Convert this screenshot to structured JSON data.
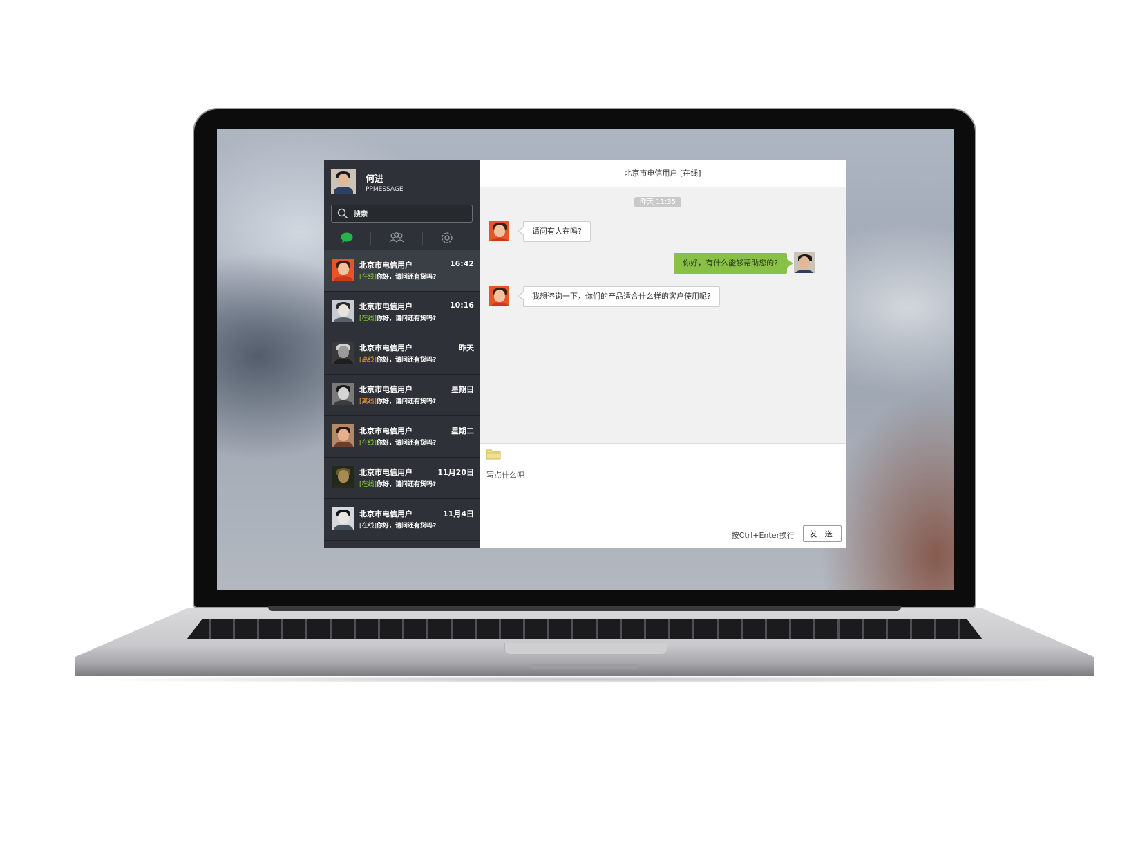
{
  "window": {
    "title": "北京市电信用户 [在线]"
  },
  "me": {
    "name": "何进",
    "subtitle": "PPMESSAGE"
  },
  "search": {
    "placeholder": "搜索"
  },
  "tabs": [
    {
      "icon": "chat-bubble-icon",
      "active": true
    },
    {
      "icon": "contacts-icon",
      "active": false
    },
    {
      "icon": "gear-icon",
      "active": false
    }
  ],
  "colors": {
    "online": "#8fd13a",
    "offline": "#f0a030",
    "sidebar": "#2e3238",
    "bubble_mine": "#88c145"
  },
  "conversations": [
    {
      "name": "北京市电信用户",
      "time": "16:42",
      "status": "[在线]",
      "status_type": "online",
      "preview": "你好，请问还有货吗?"
    },
    {
      "name": "北京市电信用户",
      "time": "10:16",
      "status": "[在线]",
      "status_type": "online",
      "preview": "你好，请问还有货吗?"
    },
    {
      "name": "北京市电信用户",
      "time": "昨天",
      "status": "[离线]",
      "status_type": "offline",
      "preview": "你好，请问还有货吗?"
    },
    {
      "name": "北京市电信用户",
      "time": "星期日",
      "status": "[离线]",
      "status_type": "offline",
      "preview": "你好，请问还有货吗?"
    },
    {
      "name": "北京市电信用户",
      "time": "星期二",
      "status": "[在线]",
      "status_type": "online",
      "preview": "你好，请问还有货吗?"
    },
    {
      "name": "北京市电信用户",
      "time": "11月20日",
      "status": "[在线]",
      "status_type": "online",
      "preview": "你好，请问还有货吗?"
    },
    {
      "name": "北京市电信用户",
      "time": "11月4日",
      "status": "[在线]",
      "status_type": "plain",
      "preview": "你好，请问还有货吗?"
    }
  ],
  "chat": {
    "timestamp": "昨天 11:35",
    "messages": [
      {
        "from": "them",
        "text": "请问有人在吗?"
      },
      {
        "from": "me",
        "text": "你好，有什么能够帮助您的?"
      },
      {
        "from": "them",
        "text": "我想咨询一下，你们的产品适合什么样的客户使用呢?"
      }
    ]
  },
  "composer": {
    "placeholder": "写点什么吧",
    "hint": "按Ctrl+Enter换行",
    "send_label": "发 送"
  }
}
